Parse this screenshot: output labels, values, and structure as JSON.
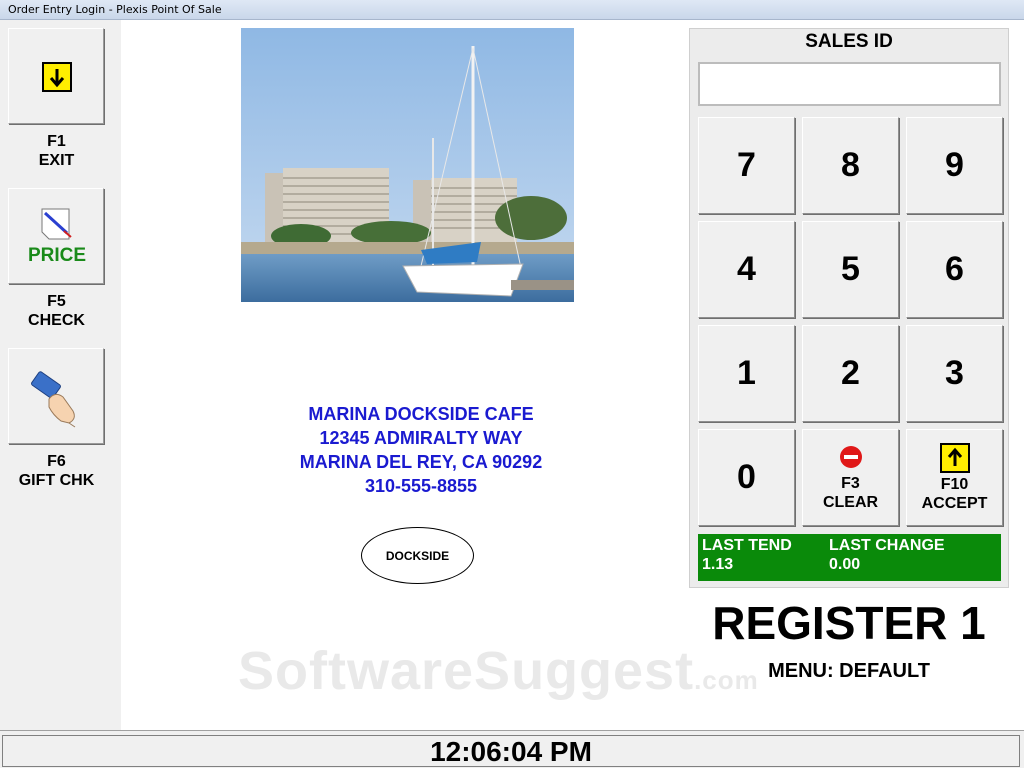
{
  "window": {
    "title": "Order Entry Login - Plexis Point Of Sale"
  },
  "left_buttons": [
    {
      "key": "F1",
      "label": "EXIT",
      "icon": "down-arrow-icon"
    },
    {
      "key": "F5",
      "label": "CHECK",
      "icon_text": "PRICE",
      "icon": "price-tag-icon",
      "icon_text_color": "#1a8a1a"
    },
    {
      "key": "F6",
      "label": "GIFT CHK",
      "icon": "card-hand-icon"
    }
  ],
  "store": {
    "name": "MARINA DOCKSIDE CAFE",
    "street": "12345 ADMIRALTY WAY",
    "city": "MARINA DEL REY, CA 90292",
    "phone": "310-555-8855",
    "badge": "DOCKSIDE",
    "photo": "marina-sailboat-image"
  },
  "sales": {
    "title": "SALES ID",
    "input_value": "",
    "keys": [
      "7",
      "8",
      "9",
      "4",
      "5",
      "6",
      "1",
      "2",
      "3",
      "0"
    ],
    "clear": {
      "key": "F3",
      "label": "CLEAR",
      "icon": "stop-icon"
    },
    "accept": {
      "key": "F10",
      "label": "ACCEPT",
      "icon": "up-arrow-icon"
    },
    "last_tend_label": "LAST TEND",
    "last_tend_value": "1.13",
    "last_change_label": "LAST CHANGE",
    "last_change_value": "0.00"
  },
  "register": {
    "name": "REGISTER 1",
    "menu": "MENU: DEFAULT"
  },
  "status": {
    "time": "12:06:04 PM"
  },
  "watermark": {
    "main": "SoftwareSuggest",
    "suffix": ".com"
  },
  "colors": {
    "accent_blue": "#1a1ad0",
    "tend_green": "#0a8a0a",
    "price_green": "#1a8a1a",
    "yellow_icon": "#ffee00"
  }
}
